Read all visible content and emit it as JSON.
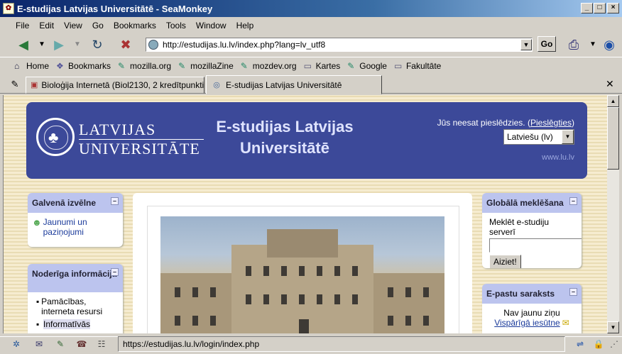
{
  "window": {
    "title": "E-studijas Latvijas Universitātē - SeaMonkey"
  },
  "menu": [
    "File",
    "Edit",
    "View",
    "Go",
    "Bookmarks",
    "Tools",
    "Window",
    "Help"
  ],
  "nav": {
    "url": "http://estudijas.lu.lv/index.php?lang=lv_utf8",
    "go_label": "Go"
  },
  "bookmarks": [
    {
      "label": "Home",
      "icon": "home-icon"
    },
    {
      "label": "Bookmarks",
      "icon": "bookmarks-icon"
    },
    {
      "label": "mozilla.org",
      "icon": "link-icon"
    },
    {
      "label": "mozillaZine",
      "icon": "link-icon"
    },
    {
      "label": "mozdev.org",
      "icon": "link-icon"
    },
    {
      "label": "Kartes",
      "icon": "folder-icon"
    },
    {
      "label": "Google",
      "icon": "link-icon"
    },
    {
      "label": "Fakultāte",
      "icon": "folder-icon"
    }
  ],
  "tabs": [
    {
      "label": "Bioloģija Internetā (Biol2130, 2 kredītpunkti...",
      "active": false
    },
    {
      "label": "E-studijas Latvijas Universitātē",
      "active": true
    }
  ],
  "page": {
    "logo_line1": "LATVIJAS",
    "logo_line2": "UNIVERSITĀTE",
    "site_title": "E-studijas Latvijas Universitātē",
    "login_text": "Jūs neesat pieslēdzies. (",
    "login_link": "Pieslēgties",
    "login_close": ")",
    "language": "Latviešu (lv)",
    "www": "www.lu.lv",
    "main_menu": {
      "title": "Galvenā izvēlne",
      "item": "Jaunumi un paziņojumi"
    },
    "useful": {
      "title": "Noderīga informācija",
      "items": [
        "Pamācības, interneta resursi",
        "Informatīvās"
      ]
    },
    "search": {
      "title": "Globālā meklēšana",
      "label": "Meklēt e-studiju serverī",
      "value": "",
      "button": "Aiziet!"
    },
    "email": {
      "title": "E-pastu saraksts",
      "no_news": "Nav jaunu ziņu",
      "inbox": "Vispārīgā iesūtne"
    }
  },
  "status": {
    "text": "https://estudijas.lu.lv/login/index.php"
  },
  "colors": {
    "header_bg": "#3c4999",
    "block_header": "#bcc4ee"
  }
}
